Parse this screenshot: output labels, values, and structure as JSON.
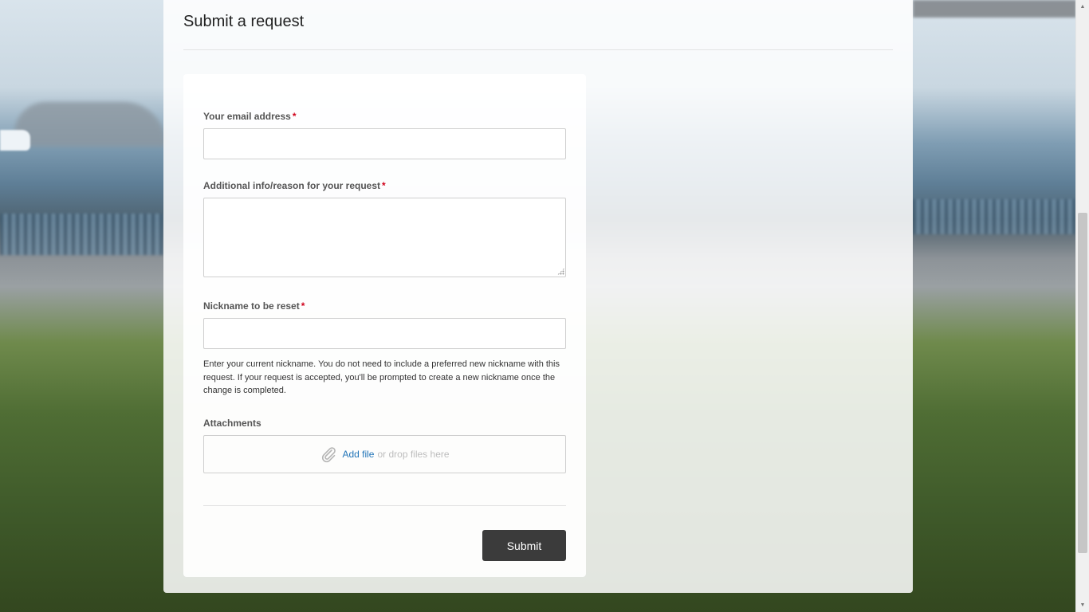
{
  "page": {
    "title": "Submit a request"
  },
  "form": {
    "email": {
      "label": "Your email address",
      "required_mark": "*",
      "value": ""
    },
    "reason": {
      "label": "Additional info/reason for your request",
      "required_mark": "*",
      "value": ""
    },
    "nickname": {
      "label": "Nickname to be reset",
      "required_mark": "*",
      "value": "",
      "hint": "Enter your current nickname. You do not need to include a preferred new nickname with this request. If your request is accepted, you'll be prompted to create a new nickname once the change is completed."
    },
    "attachments": {
      "label": "Attachments",
      "add_file": "Add file",
      "drop_text": "or drop files here",
      "icon": "paperclip-icon"
    },
    "submit_label": "Submit"
  },
  "colors": {
    "required": "#d0021b",
    "link": "#1f73b7",
    "button_bg": "#3b3b3b"
  }
}
